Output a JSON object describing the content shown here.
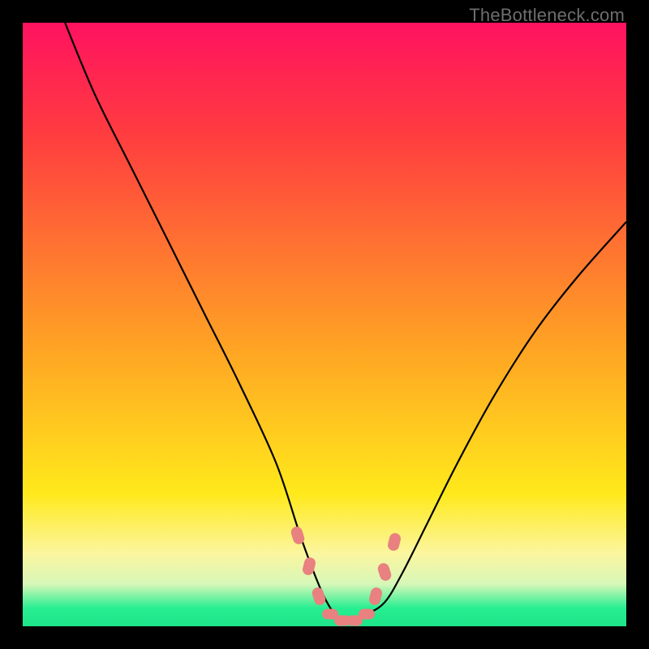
{
  "watermark": "TheBottleneck.com",
  "colors": {
    "top": "#ff1260",
    "red": "#ff3b40",
    "orange": "#ffa723",
    "yellow": "#ffe91b",
    "lightyellow": "#fbf6a0",
    "paleband": "#d7f7b8",
    "green": "#27ee91",
    "black": "#000000",
    "curve": "#000000",
    "marker": "#e8817f"
  },
  "chart_data": {
    "type": "line",
    "title": "",
    "xlabel": "",
    "ylabel": "",
    "xlim": [
      0,
      100
    ],
    "ylim": [
      0,
      100
    ],
    "series": [
      {
        "name": "bottleneck-curve",
        "x": [
          7,
          12,
          18,
          24,
          30,
          36,
          42,
          46,
          49,
          51,
          53,
          55,
          57,
          60,
          63,
          67,
          72,
          78,
          85,
          92,
          100
        ],
        "y": [
          100,
          88,
          76,
          64,
          52,
          40,
          27,
          15,
          7,
          3,
          1,
          1,
          2,
          4,
          9,
          17,
          27,
          38,
          49,
          58,
          67
        ]
      }
    ],
    "markers": {
      "name": "highlight-points",
      "x": [
        45.5,
        47.5,
        49.0,
        51.0,
        53.0,
        55.0,
        57.0,
        58.5,
        60.0,
        61.5
      ],
      "y": [
        15,
        10,
        5,
        2,
        1,
        1,
        2,
        5,
        9,
        14
      ]
    },
    "gradient_stops": [
      {
        "pct": 0,
        "color": "#ff1260"
      },
      {
        "pct": 18,
        "color": "#ff3b40"
      },
      {
        "pct": 55,
        "color": "#ffa723"
      },
      {
        "pct": 78,
        "color": "#ffe91b"
      },
      {
        "pct": 88,
        "color": "#fbf6a0"
      },
      {
        "pct": 93,
        "color": "#d7f7b8"
      },
      {
        "pct": 97,
        "color": "#27ee91"
      },
      {
        "pct": 100,
        "color": "#1de589"
      }
    ]
  }
}
